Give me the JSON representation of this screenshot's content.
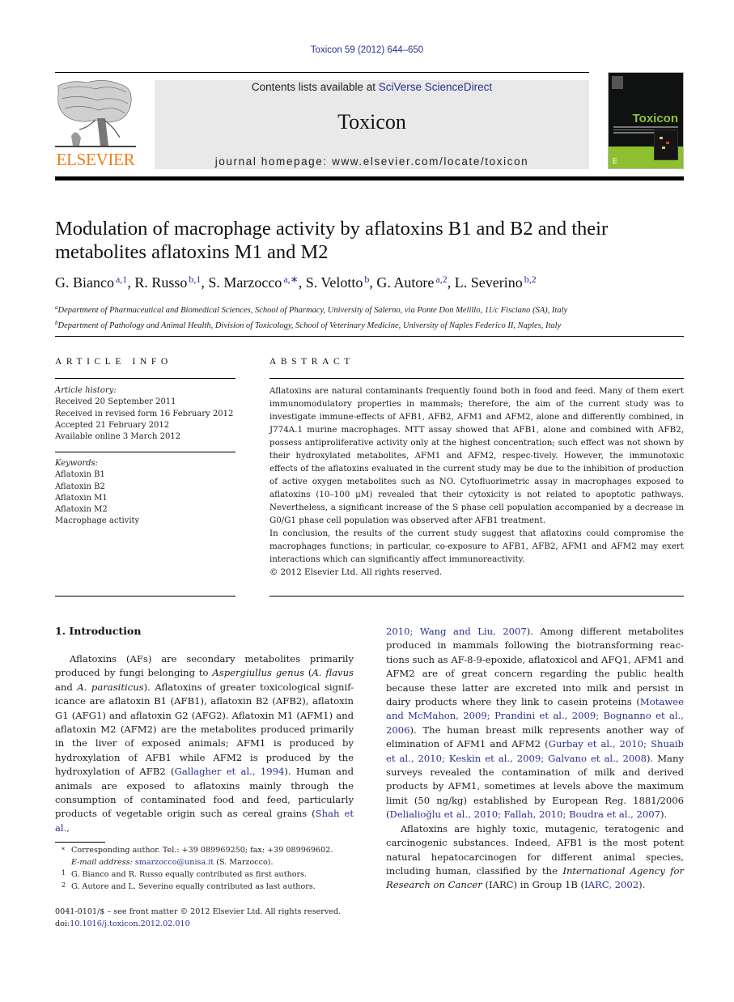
{
  "journal_citation": "Toxicon 59 (2012) 644–650",
  "masthead": {
    "publisher_logo": "ELSEVIER",
    "contents_prefix": "Contents lists available at ",
    "contents_link": "SciVerse ScienceDirect",
    "journal_name": "Toxicon",
    "homepage": "journal homepage: www.elsevier.com/locate/toxicon",
    "cover_title": "Toxicon",
    "colors": {
      "link": "#2a2f8f",
      "elsevier_orange": "#ef7d1a",
      "band_grey": "#e9e9e9",
      "cover_green": "#8dbf2f"
    }
  },
  "article": {
    "title": "Modulation of macrophage activity by aflatoxins B1 and B2 and their metabolites aflatoxins M1 and M2",
    "authors": [
      {
        "name": "G. Bianco",
        "sup": "a,1",
        "sep": ", "
      },
      {
        "name": "R. Russo",
        "sup": "b,1",
        "sep": ", "
      },
      {
        "name": "S. Marzocco",
        "sup": "a,∗",
        "sep": ", "
      },
      {
        "name": "S. Velotto",
        "sup": "b",
        "sep": ", "
      },
      {
        "name": "G. Autore",
        "sup": "a,2",
        "sep": ", "
      },
      {
        "name": "L. Severino",
        "sup": "b,2",
        "sep": ""
      }
    ],
    "affiliations": [
      {
        "mark": "a",
        "text": "Department of Pharmaceutical and Biomedical Sciences, School of Pharmacy, University of Salerno, via Ponte Don Melillo, 11/c Fisciano (SA), Italy"
      },
      {
        "mark": "b",
        "text": "Department of Pathology and Animal Health, Division of Toxicology, School of Veterinary Medicine, University of Naples Federico II, Naples, Italy"
      }
    ]
  },
  "article_info": {
    "heading": "ARTICLE INFO",
    "history_label": "Article history:",
    "history": [
      "Received 20 September 2011",
      "Received in revised form 16 February 2012",
      "Accepted 21 February 2012",
      "Available online 3 March 2012"
    ],
    "keywords_label": "Keywords:",
    "keywords": [
      "Aflatoxin B1",
      "Aflatoxin B2",
      "Aflatoxin M1",
      "Aflatoxin M2",
      "Macrophage activity"
    ]
  },
  "abstract": {
    "heading": "ABSTRACT",
    "paragraphs": [
      "Aflatoxins are natural contaminants frequently found both in food and feed. Many of them exert immunomodulatory properties in mammals; therefore, the aim of the current study was to investigate immune-effects of AFB1, AFB2, AFM1 and AFM2, alone and differently combined, in J774A.1 murine macrophages. MTT assay showed that AFB1, alone and combined with AFB2, possess antiproliferative activity only at the highest concentration; such effect was not shown by their hydroxylated metabolites, AFM1 and AFM2, respec-tively. However, the immunotoxic effects of the aflatoxins evaluated in the current study may be due to the inhibition of production of active oxygen metabolites such as NO. Cytofluorimetric assay in macrophages exposed to aflatoxins (10–100 μM) revealed that their cytoxicity is not related to apoptotic pathways. Nevertheless, a significant increase of the S phase cell population accompanied by a decrease in G0/G1 phase cell population was observed after AFB1 treatment.",
      "In conclusion, the results of the current study suggest that aflatoxins could compromise the macrophages functions; in particular, co-exposure to AFB1, AFB2, AFM1 and AFM2 may exert interactions which can significantly affect immunoreactivity."
    ],
    "copyright": "© 2012 Elsevier Ltd. All rights reserved."
  },
  "introduction": {
    "heading": "1.  Introduction",
    "left_p1": [
      {
        "t": "Aflatoxins (AFs) are secondary metabolites primarily produced by fungi belonging to "
      },
      {
        "t": "Aspergiullus genus",
        "i": true
      },
      {
        "t": " ("
      },
      {
        "t": "A. flavus",
        "i": true
      },
      {
        "t": " and "
      },
      {
        "t": "A. parasiticus",
        "i": true
      },
      {
        "t": "). Aflatoxins of greater toxicological signif-icance are aflatoxin B1 (AFB1), aflatoxin B2 (AFB2), aflatoxin G1 (AFG1) and aflatoxin G2 (AFG2). Aflatoxin M1 (AFM1) and aflatoxin M2 (AFM2) are the metabolites produced primarily in the liver of exposed animals; AFM1 is produced by hydroxylation of AFB1 while AFM2 is produced by the hydroxylation of AFB2 ("
      },
      {
        "t": "Gallagher et al., 1994",
        "link": true
      },
      {
        "t": "). Human and animals are exposed to aflatoxins mainly through the consumption of contaminated food and feed, particularly products of vegetable origin such as cereal grains ("
      },
      {
        "t": "Shah et al.,",
        "link": true
      }
    ],
    "right_p1": [
      {
        "t": "2010; Wang and Liu, 2007",
        "link": true
      },
      {
        "t": "). Among different metabolites produced in mammals following the biotransforming reac-tions such as AF-8-9-epoxide, aflatoxicol and AFQ1, AFM1 and AFM2 are of great concern regarding the public health because these latter are excreted into milk and persist in dairy products where they link to casein proteins ("
      },
      {
        "t": "Motawee and McMahon, 2009; Prandini et al., 2009; Bognanno et al., 2006",
        "link": true
      },
      {
        "t": "). The human breast milk represents another way of elimination of AFM1 and AFM2 ("
      },
      {
        "t": "Gurbay et al., 2010; Shuaib et al., 2010; Keskin et al., 2009; Galvano et al., 2008",
        "link": true
      },
      {
        "t": "). Many surveys revealed the contamination of milk and derived products by AFM1, sometimes at levels above the maximum limit (50 ng/kg) established by European Reg. 1881/2006 ("
      },
      {
        "t": "Delialioğlu et al., 2010; Fallah, 2010; Boudra et al., 2007",
        "link": true
      },
      {
        "t": ")."
      }
    ],
    "right_p2": [
      {
        "t": "Aflatoxins are highly toxic, mutagenic, teratogenic and carcinogenic substances. Indeed, AFB1 is the most potent natural hepatocarcinogen for different animal species, including human, classified by the "
      },
      {
        "t": "International Agency for Research on Cancer",
        "i": true
      },
      {
        "t": " (IARC) in Group 1B ("
      },
      {
        "t": "IARC, 2002",
        "link": true
      },
      {
        "t": ")."
      }
    ]
  },
  "footnotes": {
    "corresponding": {
      "mark": "*",
      "text": "Corresponding author. Tel.: +39 089969250; fax: +39 089969602."
    },
    "email_label": "E-mail address: ",
    "email": "smarzocco@unisa.it",
    "email_suffix": " (S. Marzocco).",
    "notes": [
      {
        "mark": "1",
        "text": "G. Bianco and R. Russo equally contributed as first authors."
      },
      {
        "mark": "2",
        "text": "G. Autore and L. Severino equally contributed as last authors."
      }
    ],
    "front_matter": "0041-0101/$ – see front matter © 2012 Elsevier Ltd. All rights reserved.",
    "doi_label": "doi:",
    "doi": "10.1016/j.toxicon.2012.02.010"
  }
}
